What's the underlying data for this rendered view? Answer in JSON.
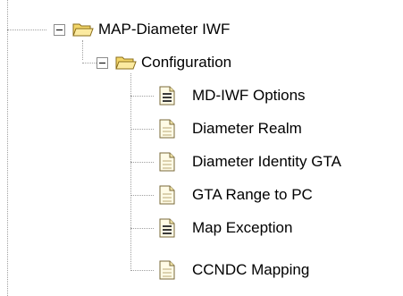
{
  "tree": {
    "root": {
      "label": "MAP-Diameter IWF",
      "icon": "folder-open-icon",
      "expanded": true
    },
    "configuration": {
      "label": "Configuration",
      "icon": "folder-open-icon",
      "expanded": true
    },
    "items": [
      {
        "label": "MD-IWF Options",
        "icon": "form-document-icon"
      },
      {
        "label": "Diameter Realm",
        "icon": "document-icon"
      },
      {
        "label": "Diameter Identity GTA",
        "icon": "document-icon"
      },
      {
        "label": "GTA Range to PC",
        "icon": "document-icon"
      },
      {
        "label": "Map Exception",
        "icon": "form-document-icon"
      },
      {
        "label": "CCNDC Mapping",
        "icon": "document-icon"
      }
    ]
  },
  "colors": {
    "connector": "#a0a0a0",
    "folder_fill": "#f8e27a",
    "folder_stroke": "#8a6d1a",
    "doc_fill": "#fffbe6",
    "doc_stroke": "#7a6a3a"
  }
}
